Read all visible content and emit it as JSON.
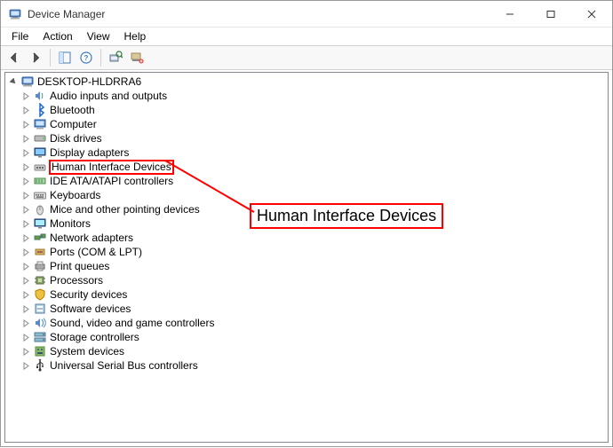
{
  "window": {
    "title": "Device Manager"
  },
  "menu": {
    "file": "File",
    "action": "Action",
    "view": "View",
    "help": "Help"
  },
  "tree": {
    "root": "DESKTOP-HLDRRA6",
    "items": [
      {
        "label": "Audio inputs and outputs",
        "icon": "audio"
      },
      {
        "label": "Bluetooth",
        "icon": "bluetooth"
      },
      {
        "label": "Computer",
        "icon": "computer"
      },
      {
        "label": "Disk drives",
        "icon": "disk"
      },
      {
        "label": "Display adapters",
        "icon": "display"
      },
      {
        "label": "Human Interface Devices",
        "icon": "hid",
        "highlight": true
      },
      {
        "label": "IDE ATA/ATAPI controllers",
        "icon": "ide"
      },
      {
        "label": "Keyboards",
        "icon": "keyboard"
      },
      {
        "label": "Mice and other pointing devices",
        "icon": "mouse"
      },
      {
        "label": "Monitors",
        "icon": "monitor"
      },
      {
        "label": "Network adapters",
        "icon": "network"
      },
      {
        "label": "Ports (COM & LPT)",
        "icon": "port"
      },
      {
        "label": "Print queues",
        "icon": "printer"
      },
      {
        "label": "Processors",
        "icon": "cpu"
      },
      {
        "label": "Security devices",
        "icon": "security"
      },
      {
        "label": "Software devices",
        "icon": "software"
      },
      {
        "label": "Sound, video and game controllers",
        "icon": "sound"
      },
      {
        "label": "Storage controllers",
        "icon": "storage"
      },
      {
        "label": "System devices",
        "icon": "system"
      },
      {
        "label": "Universal Serial Bus controllers",
        "icon": "usb"
      }
    ]
  },
  "annotation": {
    "label": "Human Interface Devices"
  }
}
